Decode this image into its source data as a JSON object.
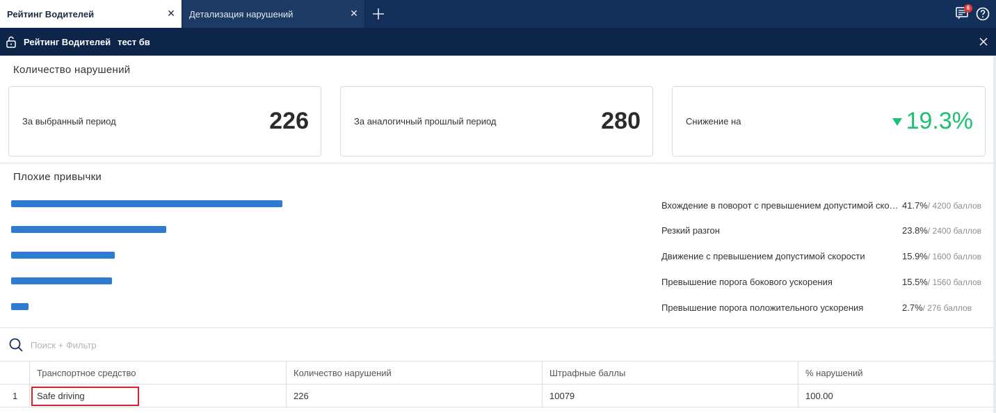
{
  "tabs": [
    {
      "label": "Рейтинг Водителей",
      "active": true
    },
    {
      "label": "Детализация нарушений",
      "active": false
    }
  ],
  "tabbar": {
    "new_tab_icon": "plus-icon",
    "messages_icon": "messages-icon",
    "messages_badge": "6",
    "help_icon": "help-icon"
  },
  "subheader": {
    "lock_icon": "unlock-icon",
    "title": "Рейтинг Водителей",
    "subtitle": "тест бв",
    "close_icon": "close-icon"
  },
  "violations": {
    "title": "Количество нарушений",
    "cards": [
      {
        "label": "За выбранный период",
        "value": "226"
      },
      {
        "label": "За аналогичный прошлый период",
        "value": "280"
      },
      {
        "label": "Снижение на",
        "value": "19.3%",
        "trend": "down",
        "color": "#1dbf73"
      }
    ]
  },
  "habits": {
    "title": "Плохие привычки",
    "items": [
      {
        "label": "Вхождение в поворот с превышением допустимой скор...",
        "percent": "41.7%",
        "points": "/ 4200 баллов",
        "share": 0.417
      },
      {
        "label": "Резкий разгон",
        "percent": "23.8%",
        "points": "/ 2400 баллов",
        "share": 0.238
      },
      {
        "label": "Движение с превышением допустимой скорости",
        "percent": "15.9%",
        "points": "/ 1600 баллов",
        "share": 0.159
      },
      {
        "label": "Превышение порога бокового ускорения",
        "percent": "15.5%",
        "points": "/ 1560 баллов",
        "share": 0.155
      },
      {
        "label": "Превышение порога положительного ускорения",
        "percent": "2.7%",
        "points": "/ 276 баллов",
        "share": 0.027
      }
    ],
    "bar_color": "#2f7bd1"
  },
  "search": {
    "placeholder": "Поиск + Фильтр",
    "icon": "search-icon"
  },
  "table": {
    "columns": [
      "",
      "Транспортное средство",
      "Количество нарушений",
      "Штрафные баллы",
      "% нарушений"
    ],
    "rows": [
      {
        "index": "1",
        "vehicle": "Safe driving",
        "violations": "226",
        "penalty": "10079",
        "percent": "100.00"
      }
    ]
  }
}
